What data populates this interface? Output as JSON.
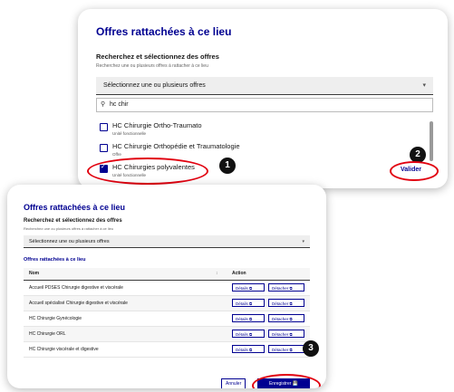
{
  "panel1": {
    "title": "Offres rattachées à ce lieu",
    "subtitle": "Recherchez et sélectionnez des offres",
    "hint": "Recherchez une ou plusieurs offres à rattacher à ce lieu",
    "select_placeholder": "Sélectionnez une ou plusieurs offres",
    "search_value": "hc chir",
    "options": [
      {
        "label": "HC Chirurgie Ortho-Traumato",
        "tag": "Unité fonctionnelle",
        "checked": false
      },
      {
        "label": "HC Chirurgie Orthopédie et Traumatologie",
        "tag": "Offre",
        "checked": false
      },
      {
        "label": "HC Chirurgies polyvalentes",
        "tag": "Unité fonctionnelle",
        "checked": true
      }
    ],
    "validate_label": "Valider"
  },
  "panel2": {
    "title": "Offres rattachées à ce lieu",
    "subtitle": "Recherchez et sélectionnez des offres",
    "hint": "Recherchez une ou plusieurs offres à rattacher à ce lieu",
    "select_placeholder": "Sélectionnez une ou plusieurs offres",
    "section_title": "Offres rattachées à ce lieu",
    "columns": [
      "Nom",
      "Action"
    ],
    "sort_mark": "↕",
    "rows": [
      "Accueil PDSES Chirurgie digestive et viscérale",
      "Accueil spécialisé Chirurgie digestive et viscérale",
      "HC Chirurgie Gynécologie",
      "HC Chirurgie ORL",
      "HC Chirurgie viscérale et digestive"
    ],
    "details_label": "Détails",
    "detach_label": "Détacher",
    "cancel_label": "Annuler",
    "save_label": "Enregistrer"
  },
  "badges": [
    "1",
    "2",
    "3"
  ],
  "colors": {
    "brand": "#000091",
    "annotation": "#e1000f",
    "badge": "#111111"
  }
}
